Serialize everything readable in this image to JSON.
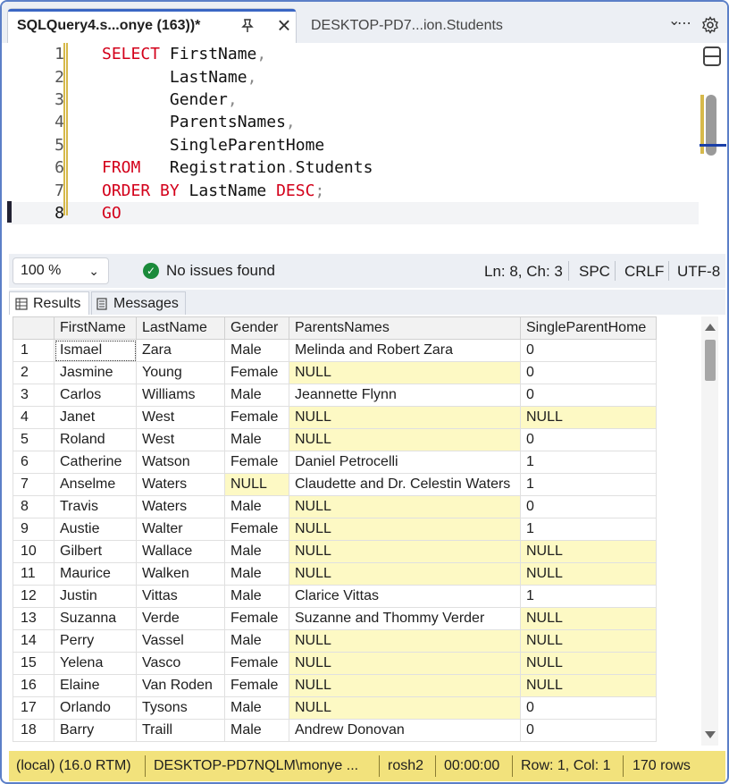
{
  "tabs": {
    "active_title": "SQLQuery4.s...onye (163))*",
    "inactive_title": "DESKTOP-PD7...ion.Students",
    "close_glyph": "×",
    "overflow_glyph": "⌄",
    "more_glyph": "⋯"
  },
  "editor": {
    "lines": [
      {
        "n": "1",
        "parts": [
          [
            "kw",
            "SELECT "
          ],
          [
            "id",
            "FirstName"
          ],
          [
            "pn",
            ","
          ]
        ]
      },
      {
        "n": "2",
        "parts": [
          [
            "id",
            "       LastName"
          ],
          [
            "pn",
            ","
          ]
        ]
      },
      {
        "n": "3",
        "parts": [
          [
            "id",
            "       Gender"
          ],
          [
            "pn",
            ","
          ]
        ]
      },
      {
        "n": "4",
        "parts": [
          [
            "id",
            "       ParentsNames"
          ],
          [
            "pn",
            ","
          ]
        ]
      },
      {
        "n": "5",
        "parts": [
          [
            "id",
            "       SingleParentHome"
          ]
        ]
      },
      {
        "n": "6",
        "parts": [
          [
            "kw",
            "FROM   "
          ],
          [
            "id",
            "Registration"
          ],
          [
            "pn",
            "."
          ],
          [
            "id",
            "Students"
          ]
        ]
      },
      {
        "n": "7",
        "parts": [
          [
            "kw",
            "ORDER BY "
          ],
          [
            "id",
            "LastName "
          ],
          [
            "kw",
            "DESC"
          ],
          [
            "pn",
            ";"
          ]
        ]
      },
      {
        "n": "8",
        "parts": [
          [
            "kw",
            "GO"
          ]
        ]
      }
    ]
  },
  "status": {
    "zoom": "100 %",
    "issues": "No issues found",
    "position": "Ln: 8, Ch: 3",
    "spacing": "SPC",
    "line_ending": "CRLF",
    "encoding": "UTF-8"
  },
  "results_tabs": {
    "results": "Results",
    "messages": "Messages"
  },
  "grid": {
    "columns": [
      "",
      "FirstName",
      "LastName",
      "Gender",
      "ParentsNames",
      "SingleParentHome"
    ],
    "rows": [
      [
        "1",
        "Ismael",
        "Zara",
        "Male",
        "Melinda and Robert Zara",
        "0"
      ],
      [
        "2",
        "Jasmine",
        "Young",
        "Female",
        "NULL",
        "0"
      ],
      [
        "3",
        "Carlos",
        "Williams",
        "Male",
        "Jeannette Flynn",
        "0"
      ],
      [
        "4",
        "Janet",
        "West",
        "Female",
        "NULL",
        "NULL"
      ],
      [
        "5",
        "Roland",
        "West",
        "Male",
        "NULL",
        "0"
      ],
      [
        "6",
        "Catherine",
        "Watson",
        "Female",
        "Daniel Petrocelli",
        "1"
      ],
      [
        "7",
        "Anselme",
        "Waters",
        "NULL",
        "Claudette and Dr. Celestin Waters",
        "1"
      ],
      [
        "8",
        "Travis",
        "Waters",
        "Male",
        "NULL",
        "0"
      ],
      [
        "9",
        "Austie",
        "Walter",
        "Female",
        "NULL",
        "1"
      ],
      [
        "10",
        "Gilbert",
        "Wallace",
        "Male",
        "NULL",
        "NULL"
      ],
      [
        "11",
        "Maurice",
        "Walken",
        "Male",
        "NULL",
        "NULL"
      ],
      [
        "12",
        "Justin",
        "Vittas",
        "Male",
        "Clarice Vittas",
        "1"
      ],
      [
        "13",
        "Suzanna",
        "Verde",
        "Female",
        "Suzanne and Thommy Verder",
        "NULL"
      ],
      [
        "14",
        "Perry",
        "Vassel",
        "Male",
        "NULL",
        "NULL"
      ],
      [
        "15",
        "Yelena",
        "Vasco",
        "Female",
        "NULL",
        "NULL"
      ],
      [
        "16",
        "Elaine",
        "Van Roden",
        "Female",
        "NULL",
        "NULL"
      ],
      [
        "17",
        "Orlando",
        "Tysons",
        "Male",
        "NULL",
        "0"
      ],
      [
        "18",
        "Barry",
        "Traill",
        "Male",
        "Andrew Donovan",
        "0"
      ]
    ]
  },
  "bottom_bar": {
    "server": "(local) (16.0 RTM)",
    "login": "DESKTOP-PD7NQLM\\monye ...",
    "database": "rosh2",
    "elapsed": "00:00:00",
    "cursor": "Row: 1, Col: 1",
    "row_count": "170 rows"
  },
  "colors": {
    "keyword": "#d3001a",
    "null_cell": "#fdf9c4",
    "status_bar": "#f2e27c",
    "accent": "#3a66c4"
  }
}
